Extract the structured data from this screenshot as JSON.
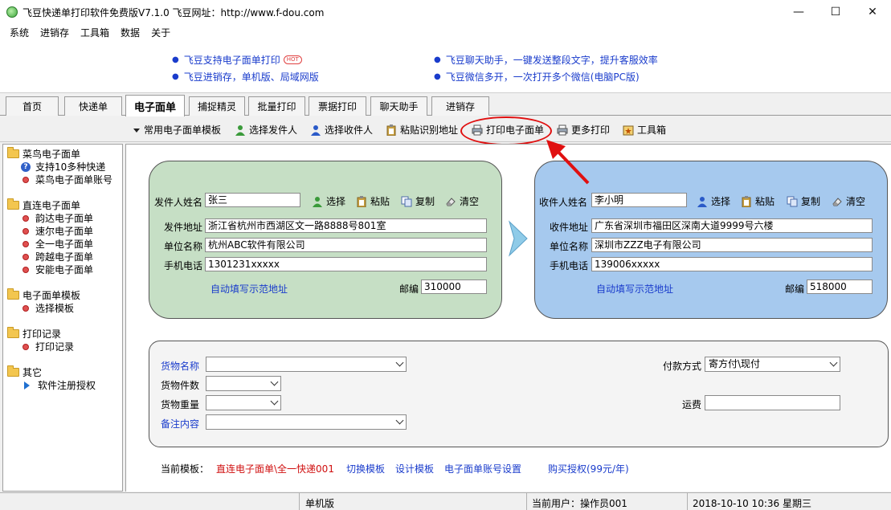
{
  "window": {
    "title": "飞豆快递单打印软件免费版V7.1.0   飞豆网址：http://www.f-dou.com",
    "minimize": "—",
    "maximize": "☐",
    "close": "✕"
  },
  "menu": [
    "系统",
    "进销存",
    "工具箱",
    "数据",
    "关于"
  ],
  "ads": {
    "left": [
      "飞豆支持电子面单打印",
      "飞豆进销存，单机版、局域网版"
    ],
    "hot": "HOT",
    "right": [
      "飞豆聊天助手，一键发送整段文字，提升客服效率",
      "飞豆微信多开，一次打开多个微信(电脑PC版)"
    ]
  },
  "tabs": [
    "首页",
    "快递单",
    "电子面单",
    "捕捉精灵",
    "批量打印",
    "票据打印",
    "聊天助手",
    "进销存"
  ],
  "toolbar": {
    "templates": "常用电子面单模板",
    "select_sender": "选择发件人",
    "select_receiver": "选择收件人",
    "paste_address": "粘贴识别地址",
    "print": "打印电子面单",
    "more_print": "更多打印",
    "toolbox": "工具箱"
  },
  "sidebar": {
    "groups": [
      {
        "label": "菜鸟电子面单",
        "items": [
          "支持10多种快递",
          "菜鸟电子面单账号"
        ]
      },
      {
        "label": "直连电子面单",
        "items": [
          "韵达电子面单",
          "速尔电子面单",
          "全一电子面单",
          "跨越电子面单",
          "安能电子面单"
        ]
      },
      {
        "label": "电子面单模板",
        "items": [
          "选择模板"
        ]
      },
      {
        "label": "打印记录",
        "items": [
          "打印记录"
        ]
      },
      {
        "label": "其它",
        "items": [
          "软件注册授权"
        ]
      }
    ]
  },
  "sender": {
    "name_label": "发件人姓名",
    "name": "张三",
    "select": "选择",
    "paste": "粘贴",
    "copy": "复制",
    "clear": "清空",
    "address_label": "发件地址",
    "address": "浙江省杭州市西湖区文一路8888号801室",
    "company_label": "单位名称",
    "company": "杭州ABC软件有限公司",
    "phone_label": "手机电话",
    "phone": "1301231xxxxx",
    "autofill": "自动填写示范地址",
    "zip_label": "邮编",
    "zip": "310000"
  },
  "receiver": {
    "name_label": "收件人姓名",
    "name": "李小明",
    "select": "选择",
    "paste": "粘贴",
    "copy": "复制",
    "clear": "清空",
    "address_label": "收件地址",
    "address": "广东省深圳市福田区深南大道9999号六楼",
    "company_label": "单位名称",
    "company": "深圳市ZZZ电子有限公司",
    "phone_label": "手机电话",
    "phone": "139006xxxxx",
    "autofill": "自动填写示范地址",
    "zip_label": "邮编",
    "zip": "518000"
  },
  "goods": {
    "name_label": "货物名称",
    "name": "",
    "count_label": "货物件数",
    "count": "",
    "weight_label": "货物重量",
    "weight": "",
    "remark_label": "备注内容",
    "remark": "",
    "payment_label": "付款方式",
    "payment": "寄方付\\现付",
    "freight_label": "运费",
    "freight": ""
  },
  "footer": {
    "current_template_label": "当前模板：",
    "current_template": "直连电子面单\\全一快递001",
    "switch_template": "切换模板",
    "design_template": "设计模板",
    "account_settings": "电子面单账号设置",
    "buy_license": "购买授权(99元/年)"
  },
  "status": {
    "mode": "单机版",
    "user": "当前用户：操作员001",
    "datetime": "2018-10-10  10:36  星期三"
  }
}
